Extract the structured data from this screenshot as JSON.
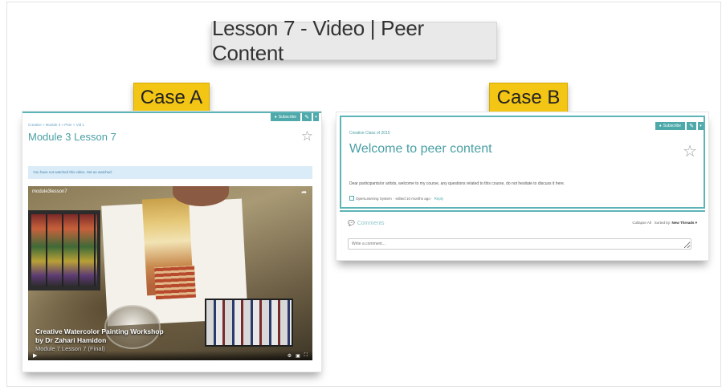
{
  "title": "Lesson 7 - Video | Peer Content",
  "case_a": {
    "tag": "Case A",
    "toolbar": {
      "subscribe": "Subscribe",
      "edit_icon": "pencil-icon",
      "dropdown_icon": "caret-down-icon"
    },
    "breadcrumb": "Creative » Module 3 » Peer » Vid 1",
    "module_title": "Module 3 Lesson 7",
    "alert": "You have not watched this video. Set as watched.",
    "video": {
      "top_label": "module3lesson7",
      "caption_line1": "Creative Watercolor Painting Workshop",
      "caption_line2": "by Dr Zahari Hamidon",
      "caption_line3": "Module 7 Lesson 7 (Final)"
    }
  },
  "case_b": {
    "tag": "Case B",
    "toolbar": {
      "subscribe": "Subscribe",
      "edit_icon": "pencil-icon",
      "dropdown_icon": "caret-down-icon"
    },
    "class_label": "Creative Class of 2015",
    "title": "Welcome to peer content",
    "body": "Dear participants/or artists, welcome to my course, any questions related to this course, do not hesitate to discuss it here.",
    "meta_author": "OpenLearning System",
    "meta_time": " · edited 10 months ago · ",
    "meta_link": "Reply",
    "comments_title": "Comments",
    "collapse_all": "Collapse All",
    "sorted_by_label": "Sorted by:",
    "sorted_by_value": "New Threads ▾",
    "comment_placeholder": "Write a comment..."
  },
  "colors": {
    "accent": "#5db4b7",
    "tag_yellow": "#f3c514",
    "banner_grey": "#e9e9e9"
  }
}
